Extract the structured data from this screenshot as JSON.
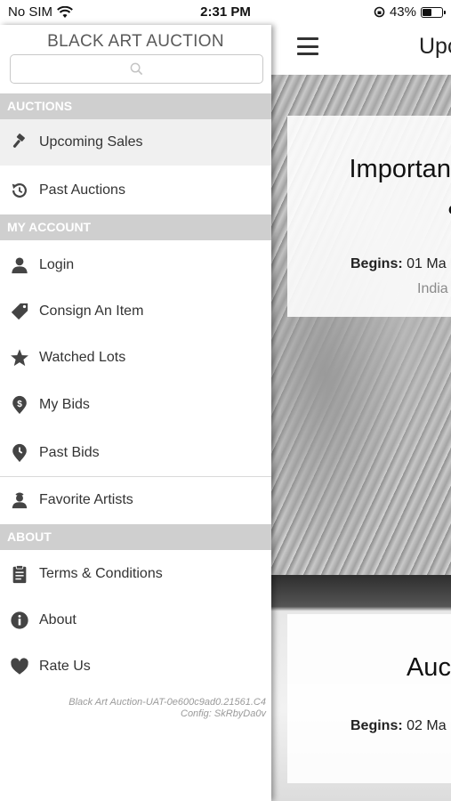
{
  "status": {
    "carrier": "No SIM",
    "time": "2:31 PM",
    "battery_percent": "43%",
    "battery_level": 0.43
  },
  "drawer": {
    "brand": "BLACK ART AUCTION",
    "search_placeholder": "",
    "sections": {
      "auctions": "AUCTIONS",
      "my_account": "MY ACCOUNT",
      "about": "ABOUT"
    },
    "items": {
      "upcoming_sales": "Upcoming Sales",
      "past_auctions": "Past Auctions",
      "login": "Login",
      "consign": "Consign An Item",
      "watched_lots": "Watched Lots",
      "my_bids": "My Bids",
      "past_bids": "Past Bids",
      "favorite_artists": "Favorite Artists",
      "terms": "Terms & Conditions",
      "about": "About",
      "rate_us": "Rate Us"
    },
    "version_line1": "Black Art Auction-UAT-0e600c9ad0.21561.C4",
    "version_line2": "Config: SkRbyDa0v"
  },
  "main": {
    "title": "Upc",
    "cards": [
      {
        "title": "Important",
        "subtitle": "&",
        "begins_label": "Begins:",
        "begins_value": "01 Ma",
        "location": "India"
      },
      {
        "title": "Auct",
        "begins_label": "Begins:",
        "begins_value": "02 Ma"
      }
    ]
  },
  "icons": {
    "wifi": "wifi-icon",
    "lock_rotation": "rotation-lock-icon",
    "battery": "battery-icon",
    "menu": "hamburger-menu-icon",
    "search": "search-icon",
    "gavel": "gavel-icon",
    "history": "history-icon",
    "user": "user-icon",
    "tag": "tag-icon",
    "star": "star-icon",
    "dollar": "dollar-pin-icon",
    "clock": "clock-pin-icon",
    "artist": "artist-icon",
    "clipboard": "clipboard-icon",
    "info": "info-icon",
    "heart": "heart-icon"
  },
  "colors": {
    "section_bg": "#cfcfcf",
    "icon": "#444444",
    "active_bg": "#f0f0f0"
  }
}
